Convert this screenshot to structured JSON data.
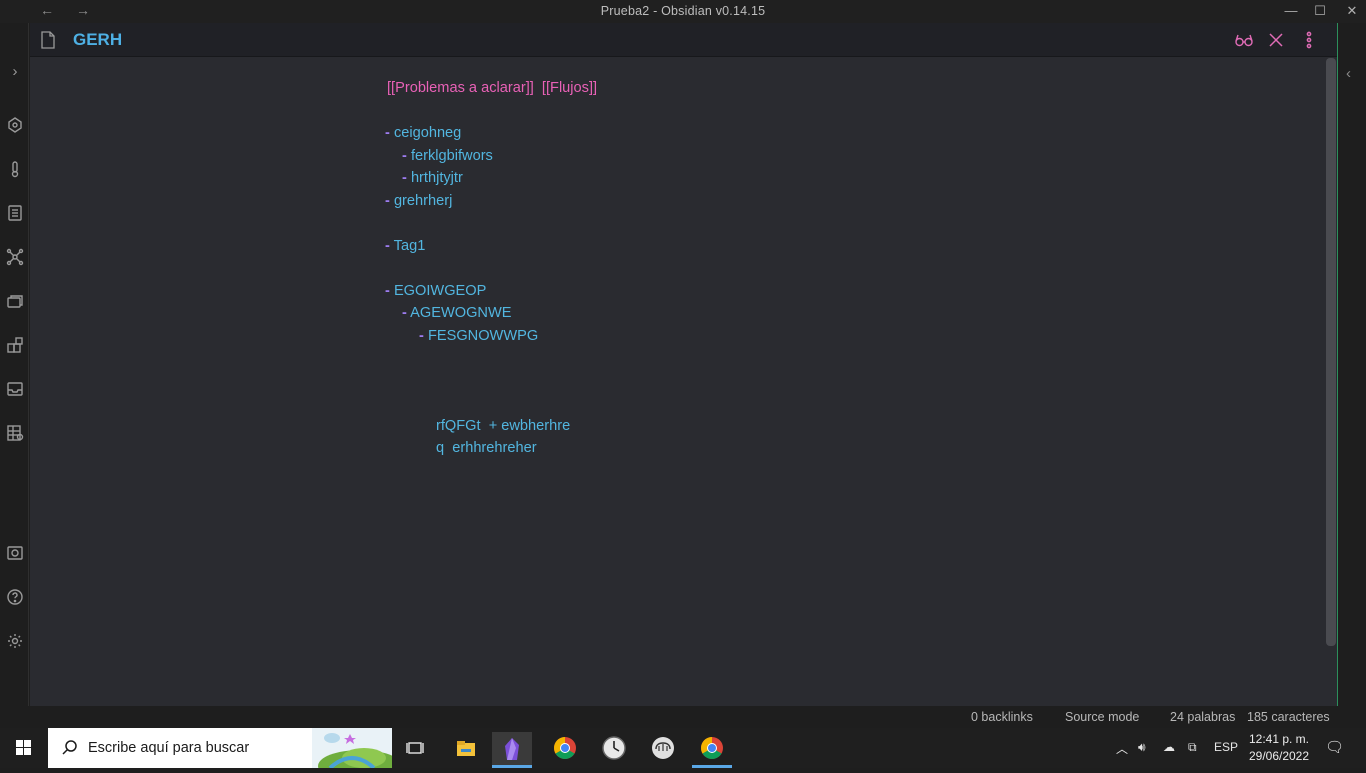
{
  "window": {
    "title": "Prueba2 - Obsidian v0.14.15",
    "back_icon": "arrow-left-icon",
    "forward_icon": "arrow-right-icon"
  },
  "note": {
    "title": "GERH",
    "links_line": "[[Problemas a aclarar]]  [[Flujos]]",
    "bullets": [
      {
        "level": 0,
        "text": "ceigohneg"
      },
      {
        "level": 1,
        "text": "ferklgbifwors"
      },
      {
        "level": 1,
        "text": "hrthjtyjtr"
      },
      {
        "level": 0,
        "text": "grehrherj"
      },
      {
        "level": 0,
        "text": "Tag1"
      },
      {
        "level": 0,
        "text": "EGOIWGEOP"
      },
      {
        "level": 1,
        "text": "AGEWOGNWE"
      },
      {
        "level": 2,
        "text": "FESGNOWWPG"
      }
    ],
    "dash": "-",
    "extra_lines": [
      "rfQFGt  + ewbherhre",
      "q  erhhrehreher"
    ]
  },
  "status": {
    "backlinks": "0 backlinks",
    "mode": "Source mode",
    "words": "24 palabras",
    "chars": "185 caracteres"
  },
  "taskbar": {
    "search_placeholder": "Escribe aquí para buscar",
    "language": "ESP",
    "time": "12:41 p. m.",
    "date": "29/06/2022"
  },
  "colors": {
    "accent_blue": "#52b6e0",
    "link_pink": "#e861b6",
    "list_dash": "#9d7cf0"
  }
}
